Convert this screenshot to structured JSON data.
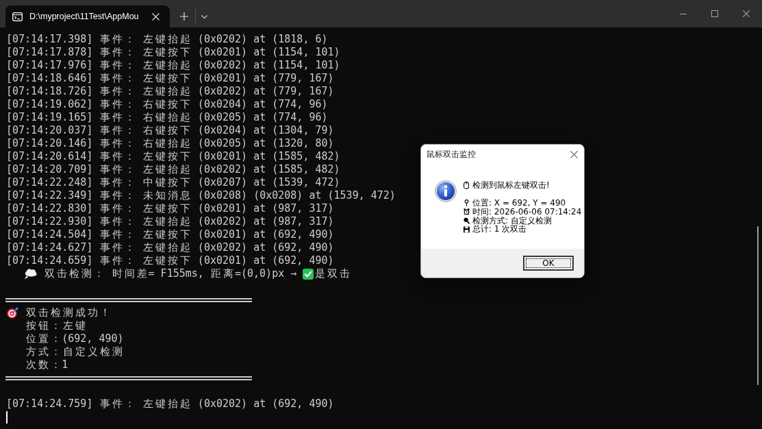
{
  "window": {
    "tab": {
      "title": "D:\\myproject\\11Test\\AppMou",
      "selected": true
    }
  },
  "console": {
    "log_lines": [
      "[07:14:17.398] 事件： 左键抬起 (0x0202) at (1818, 6)",
      "[07:14:17.878] 事件： 左键按下 (0x0201) at (1154, 101)",
      "[07:14:17.976] 事件： 左键抬起 (0x0202) at (1154, 101)",
      "[07:14:18.646] 事件： 左键按下 (0x0201) at (779, 167)",
      "[07:14:18.726] 事件： 左键抬起 (0x0202) at (779, 167)",
      "[07:14:19.062] 事件： 右键按下 (0x0204) at (774, 96)",
      "[07:14:19.165] 事件： 右键抬起 (0x0205) at (774, 96)",
      "[07:14:20.037] 事件： 右键按下 (0x0204) at (1304, 79)",
      "[07:14:20.146] 事件： 右键抬起 (0x0205) at (1320, 80)",
      "[07:14:20.614] 事件： 左键按下 (0x0201) at (1585, 482)",
      "[07:14:20.709] 事件： 左键抬起 (0x0202) at (1585, 482)",
      "[07:14:22.248] 事件： 中键按下 (0x0207) at (1539, 472)",
      "[07:14:22.349] 事件： 未知消息 (0x0208) (0x0208) at (1539, 472)",
      "[07:14:22.830] 事件： 左键按下 (0x0201) at (987, 317)",
      "[07:14:22.930] 事件： 左键抬起 (0x0202) at (987, 317)",
      "[07:14:24.504] 事件： 左键按下 (0x0201) at (692, 490)",
      "[07:14:24.627] 事件： 左键抬起 (0x0202) at (692, 490)",
      "[07:14:24.659] 事件： 左键按下 (0x0201) at (692, 490)"
    ],
    "detection_line": {
      "text": "双击检测： 时间差= F155ms, 距离=(0,0)px →",
      "result": "是双击"
    },
    "success_block": {
      "heading": "双击检测成功！",
      "details": [
        "按钮：左键",
        "位置：(692, 490)",
        "方式：自定义检测",
        "次数：1"
      ]
    },
    "after_lines": [
      "[07:14:24.759] 事件： 左键抬起 (0x0202) at (692, 490)"
    ]
  },
  "dialog": {
    "title": "鼠标双击监控",
    "message": "检测到鼠标左键双击!",
    "details": [
      {
        "kind": "pin",
        "text": "位置: X = 692, Y = 490"
      },
      {
        "kind": "clock",
        "text": "时间: 2026-06-06 07:14:24"
      },
      {
        "kind": "magnifier",
        "text": "检测方式: 自定义检测"
      },
      {
        "kind": "disk",
        "text": "总计: 1 次双击"
      }
    ],
    "buttons": [
      {
        "label": "OK",
        "focused": true
      }
    ]
  }
}
